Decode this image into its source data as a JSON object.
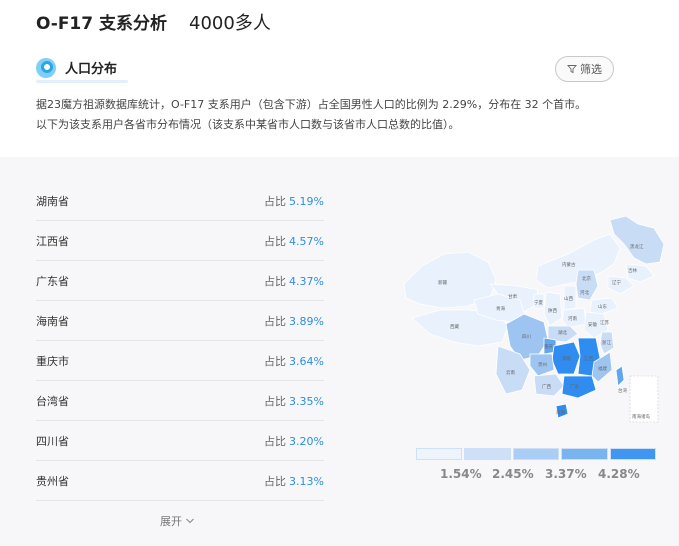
{
  "header": {
    "title": "O-F17 支系分析",
    "count": "4000多人"
  },
  "section": {
    "title": "人口分布",
    "filter_label": "筛选",
    "description_line1": "据23魔方祖源数据库统计，O-F17 支系用户（包含下游）占全国男性人口的比例为 2.29%，分布在 32 个首市。",
    "description_line2": "以下为该支系用户各省市分布情况（该支系中某省市人口数与该省市人口总数的比值）。"
  },
  "list": {
    "share_prefix": "占比",
    "rows": [
      {
        "name": "湖南省",
        "pct": "5.19%"
      },
      {
        "name": "江西省",
        "pct": "4.57%"
      },
      {
        "name": "广东省",
        "pct": "4.37%"
      },
      {
        "name": "海南省",
        "pct": "3.89%"
      },
      {
        "name": "重庆市",
        "pct": "3.64%"
      },
      {
        "name": "台湾省",
        "pct": "3.35%"
      },
      {
        "name": "四川省",
        "pct": "3.20%"
      },
      {
        "name": "贵州省",
        "pct": "3.13%"
      }
    ],
    "expand_label": "展开"
  },
  "map": {
    "colors": {
      "level0": "#e8f1fc",
      "level1": "#c8dcf6",
      "level2": "#9ec5f2",
      "level3": "#62a6ee",
      "level4": "#2f8cf0"
    },
    "region_labels": [
      "黑龙江",
      "吉林",
      "辽宁",
      "内蒙古",
      "北京",
      "河北",
      "山西",
      "新疆",
      "西藏",
      "青海",
      "甘肃",
      "宁夏",
      "陕西",
      "河南",
      "山东",
      "江苏",
      "安徽",
      "湖北",
      "四川",
      "重庆",
      "湖南",
      "江西",
      "浙江",
      "福建",
      "云南",
      "贵州",
      "广西",
      "广东",
      "海南",
      "台湾",
      "南海诸岛"
    ]
  },
  "legend": {
    "labels": [
      "1.54%",
      "2.45%",
      "3.37%",
      "4.28%"
    ],
    "colors": [
      "#eef4fc",
      "#cde0f7",
      "#a9cdf4",
      "#78b4f0",
      "#3f97f3"
    ]
  }
}
